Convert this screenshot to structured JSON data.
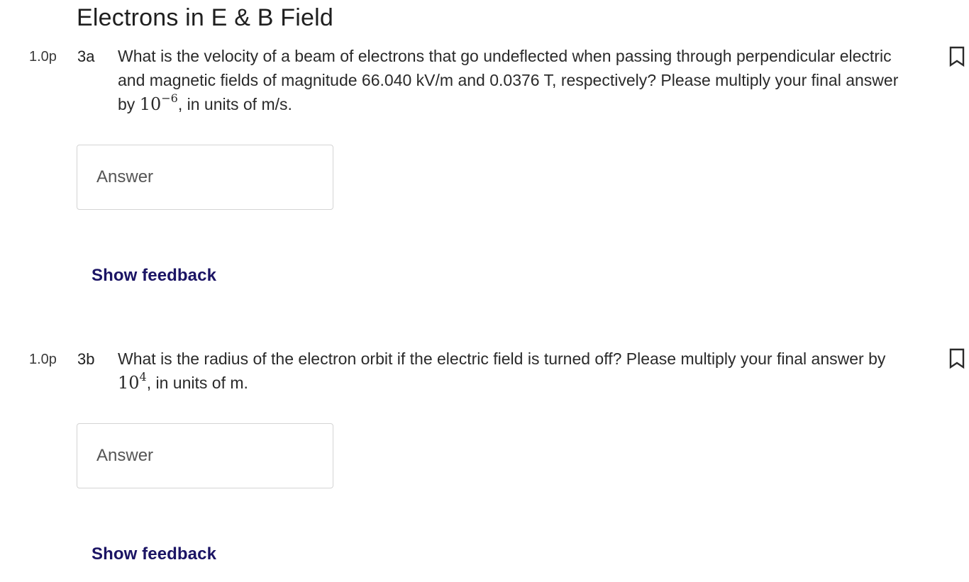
{
  "page": {
    "title": "Electrons in E & B Field"
  },
  "questions": [
    {
      "points": "1.0p",
      "number": "3a",
      "text_part1": "What is the velocity of a beam of electrons that go undeflected when passing through perpendicular electric and magnetic fields of magnitude 66.040 kV/m and 0.0376 T, respectively? Please multiply your final answer by ",
      "math_base": "10",
      "math_exp": "−6",
      "text_part2": ", in units of m/s.",
      "answer_placeholder": "Answer",
      "answer_value": "",
      "feedback_label": "Show feedback",
      "bookmark_icon": "bookmark-icon"
    },
    {
      "points": "1.0p",
      "number": "3b",
      "text_part1": "What is the radius of the electron orbit if the electric field is turned off? Please multiply your final answer by ",
      "math_base": "10",
      "math_exp": "4",
      "text_part2": ", in units of m.",
      "answer_placeholder": "Answer",
      "answer_value": "",
      "feedback_label": "Show feedback",
      "bookmark_icon": "bookmark-icon"
    }
  ],
  "colors": {
    "feedback_link": "#1b1464",
    "input_border": "#d4d4d4",
    "text": "#2a2a2a"
  }
}
